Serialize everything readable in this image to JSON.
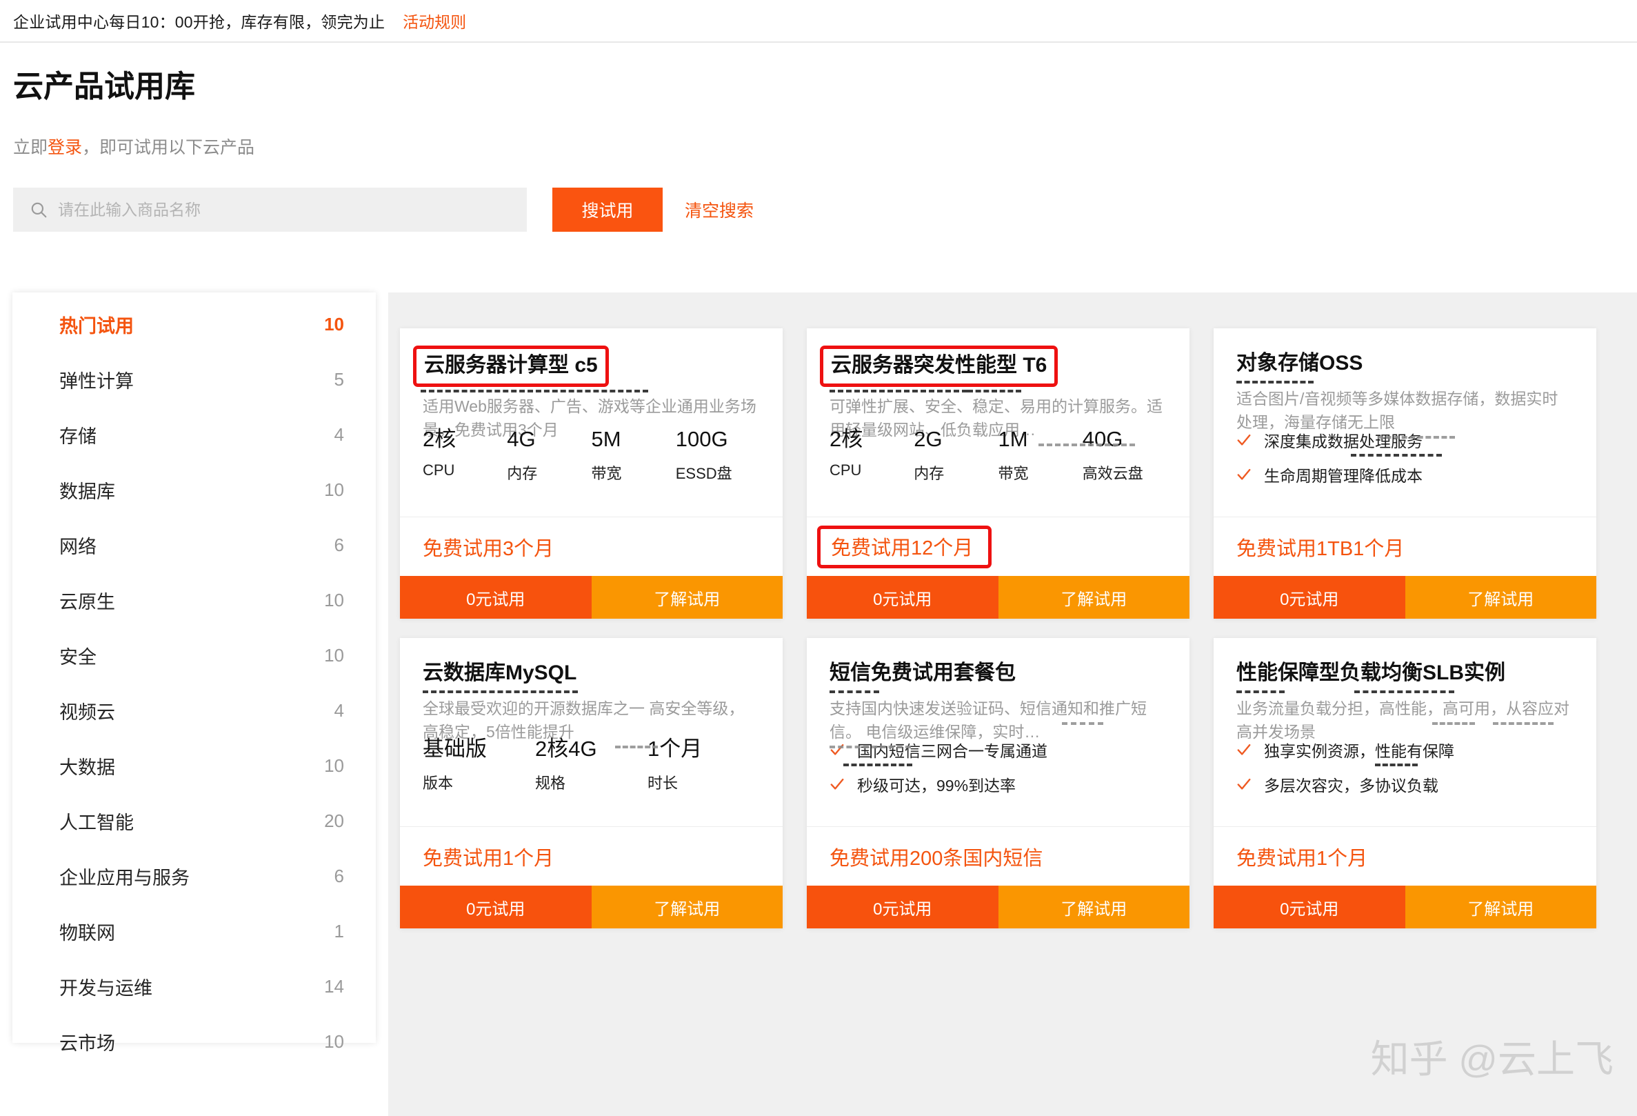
{
  "notice": {
    "text": "企业试用中心每日10：00开抢，库存有限，领完为止",
    "rules_label": "活动规则"
  },
  "page": {
    "title": "云产品试用库",
    "sub_prefix": "立即",
    "sub_link": "登录",
    "sub_suffix": "，即可试用以下云产品"
  },
  "search": {
    "placeholder": "请在此输入商品名称",
    "value": "",
    "button_label": "搜试用",
    "clear_label": "清空搜索",
    "icon": "search-icon"
  },
  "sidebar": {
    "items": [
      {
        "label": "热门试用",
        "count": "10",
        "active": true
      },
      {
        "label": "弹性计算",
        "count": "5",
        "active": false
      },
      {
        "label": "存储",
        "count": "4",
        "active": false
      },
      {
        "label": "数据库",
        "count": "10",
        "active": false
      },
      {
        "label": "网络",
        "count": "6",
        "active": false
      },
      {
        "label": "云原生",
        "count": "10",
        "active": false
      },
      {
        "label": "安全",
        "count": "10",
        "active": false
      },
      {
        "label": "视频云",
        "count": "4",
        "active": false
      },
      {
        "label": "大数据",
        "count": "10",
        "active": false
      },
      {
        "label": "人工智能",
        "count": "20",
        "active": false
      },
      {
        "label": "企业应用与服务",
        "count": "6",
        "active": false
      },
      {
        "label": "物联网",
        "count": "1",
        "active": false
      },
      {
        "label": "开发与运维",
        "count": "14",
        "active": false
      },
      {
        "label": "云市场",
        "count": "10",
        "active": false
      }
    ]
  },
  "cards": [
    {
      "title": "云服务器计算型 c5",
      "title_boxed": true,
      "desc": "适用Web服务器、广告、游戏等企业通用业务场景，免费试用3个月",
      "specs": [
        {
          "value": "2核",
          "label": "CPU"
        },
        {
          "value": "4G",
          "label": "内存"
        },
        {
          "value": "5M",
          "label": "带宽"
        },
        {
          "value": "100G",
          "label": "ESSD盘"
        }
      ],
      "features": [],
      "trial": "免费试用3个月",
      "trial_boxed": false,
      "free_label": "0元试用",
      "learn_label": "了解试用"
    },
    {
      "title": "云服务器突发性能型 T6",
      "title_boxed": true,
      "desc": "可弹性扩展、安全、稳定、易用的计算服务。适用轻量级网站、低负载应用…",
      "specs": [
        {
          "value": "2核",
          "label": "CPU"
        },
        {
          "value": "2G",
          "label": "内存"
        },
        {
          "value": "1M",
          "label": "带宽"
        },
        {
          "value": "40G",
          "label": "高效云盘"
        }
      ],
      "features": [],
      "trial": "免费试用12个月",
      "trial_boxed": true,
      "free_label": "0元试用",
      "learn_label": "了解试用"
    },
    {
      "title": "对象存储OSS",
      "title_boxed": false,
      "desc": "适合图片/音视频等多媒体数据存储，数据实时处理，海量存储无上限",
      "specs": [],
      "features": [
        "深度集成数据处理服务",
        "生命周期管理降低成本"
      ],
      "trial": "免费试用1TB1个月",
      "trial_boxed": false,
      "free_label": "0元试用",
      "learn_label": "了解试用"
    },
    {
      "title": "云数据库MySQL",
      "title_boxed": false,
      "desc": "全球最受欢迎的开源数据库之一 高安全等级，高稳定，5倍性能提升",
      "specs": [
        {
          "value": "基础版",
          "label": "版本"
        },
        {
          "value": "2核4G",
          "label": "规格"
        },
        {
          "value": "1个月",
          "label": "时长"
        }
      ],
      "features": [],
      "trial": "免费试用1个月",
      "trial_boxed": false,
      "free_label": "0元试用",
      "learn_label": "了解试用"
    },
    {
      "title": "短信免费试用套餐包",
      "title_boxed": false,
      "desc": "支持国内快速发送验证码、短信通知和推广短信。 电信级运维保障，实时…",
      "specs": [],
      "features": [
        "国内短信三网合一专属通道",
        "秒级可达，99%到达率"
      ],
      "trial": "免费试用200条国内短信",
      "trial_boxed": false,
      "free_label": "0元试用",
      "learn_label": "了解试用"
    },
    {
      "title": "性能保障型负载均衡SLB实例",
      "title_boxed": false,
      "desc": "业务流量负载分担，高性能，高可用，从容应对高并发场景",
      "specs": [],
      "features": [
        "独享实例资源，性能有保障",
        "多层次容灾，多协议负载"
      ],
      "trial": "免费试用1个月",
      "trial_boxed": false,
      "free_label": "0元试用",
      "learn_label": "了解试用"
    }
  ],
  "watermark": "知乎 @云上飞",
  "colors": {
    "brand_orange": "#fa5410",
    "btn_free": "#f7520d",
    "btn_learn": "#fa9601",
    "annotation_red": "#ee1111",
    "content_bg": "#f0f0f0"
  }
}
